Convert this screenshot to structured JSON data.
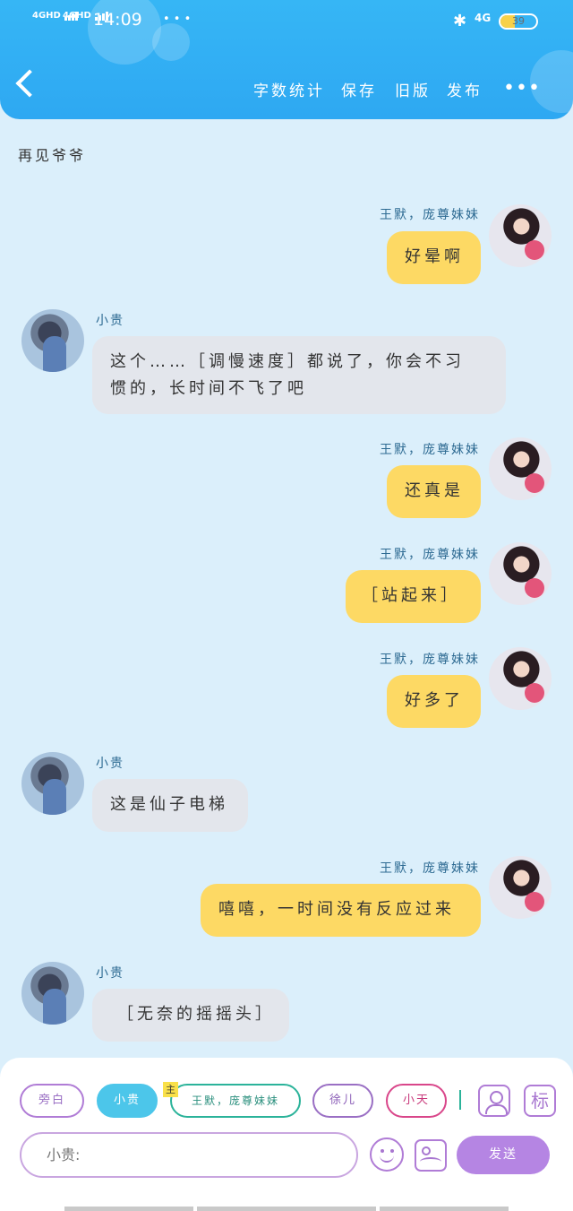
{
  "status_bar": {
    "signal1": "4GHD",
    "signal2": "4GHD",
    "time": "14:09",
    "extra": "• • •",
    "network": "4G",
    "battery": "39"
  },
  "header": {
    "buttons": [
      "字数统计",
      "保存",
      "旧版",
      "发布"
    ],
    "more": "•••"
  },
  "narration": "再见爷爷",
  "messages": [
    {
      "side": "right",
      "name": "王默，庞尊妹妹",
      "text": "好晕啊"
    },
    {
      "side": "left",
      "name": "小贵",
      "text_lines": [
        "这个……［调慢速度］都说了，你会不习",
        "惯的，长时间不飞了吧"
      ]
    },
    {
      "side": "right",
      "name": "王默，庞尊妹妹",
      "text": "还真是"
    },
    {
      "side": "right",
      "name": "王默，庞尊妹妹",
      "text": "［站起来］"
    },
    {
      "side": "right",
      "name": "王默，庞尊妹妹",
      "text": "好多了"
    },
    {
      "side": "left",
      "name": "小贵",
      "text": "这是仙子电梯"
    },
    {
      "side": "right",
      "name": "王默，庞尊妹妹",
      "text": "嘻嘻，一时间没有反应过来"
    },
    {
      "side": "left",
      "name": "小贵",
      "text": "［无奈的摇摇头］"
    }
  ],
  "characters": [
    {
      "label": "旁白",
      "color": "#b07cd6"
    },
    {
      "label": "小贵",
      "color": "#4cc6ea",
      "selected": true
    },
    {
      "label": "王默，庞尊妹妹",
      "color": "#2bb39a",
      "main_tag": "主"
    },
    {
      "label": "徐儿",
      "color": "#9a6fc4"
    },
    {
      "label": "小天",
      "color": "#d9468a"
    }
  ],
  "tools": {
    "tag_icon": "标"
  },
  "composer": {
    "placeholder": "小贵:",
    "send_label": "发送"
  }
}
